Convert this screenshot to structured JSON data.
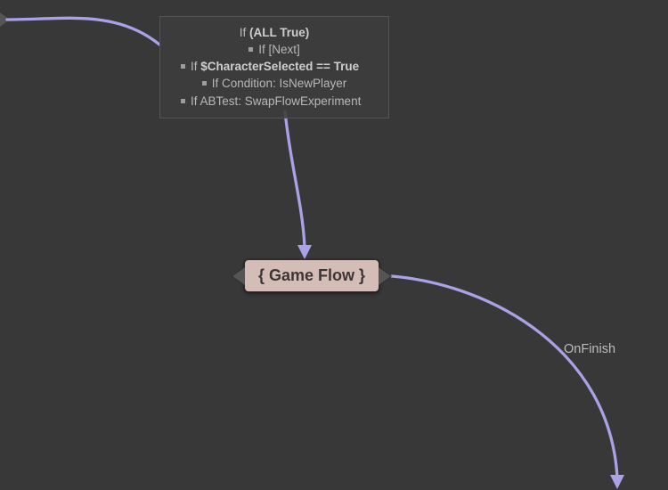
{
  "condition_box": {
    "header_prefix": "If ",
    "header_bold": "(ALL True)",
    "lines": [
      {
        "indent": 1,
        "text": "If [Next]"
      },
      {
        "indent": 0,
        "prefix": "If ",
        "bold": "$CharacterSelected == True"
      },
      {
        "indent": 1,
        "text": "If Condition: IsNewPlayer"
      },
      {
        "indent": 0,
        "text": "If ABTest: SwapFlowExperiment"
      }
    ]
  },
  "flow_node": {
    "label": "{ Game Flow }"
  },
  "edge_labels": {
    "on_finish": "OnFinish"
  },
  "colors": {
    "wire": "#a9a2e6",
    "canvas_bg": "#383838",
    "node_fill": "#d5bdb7"
  }
}
